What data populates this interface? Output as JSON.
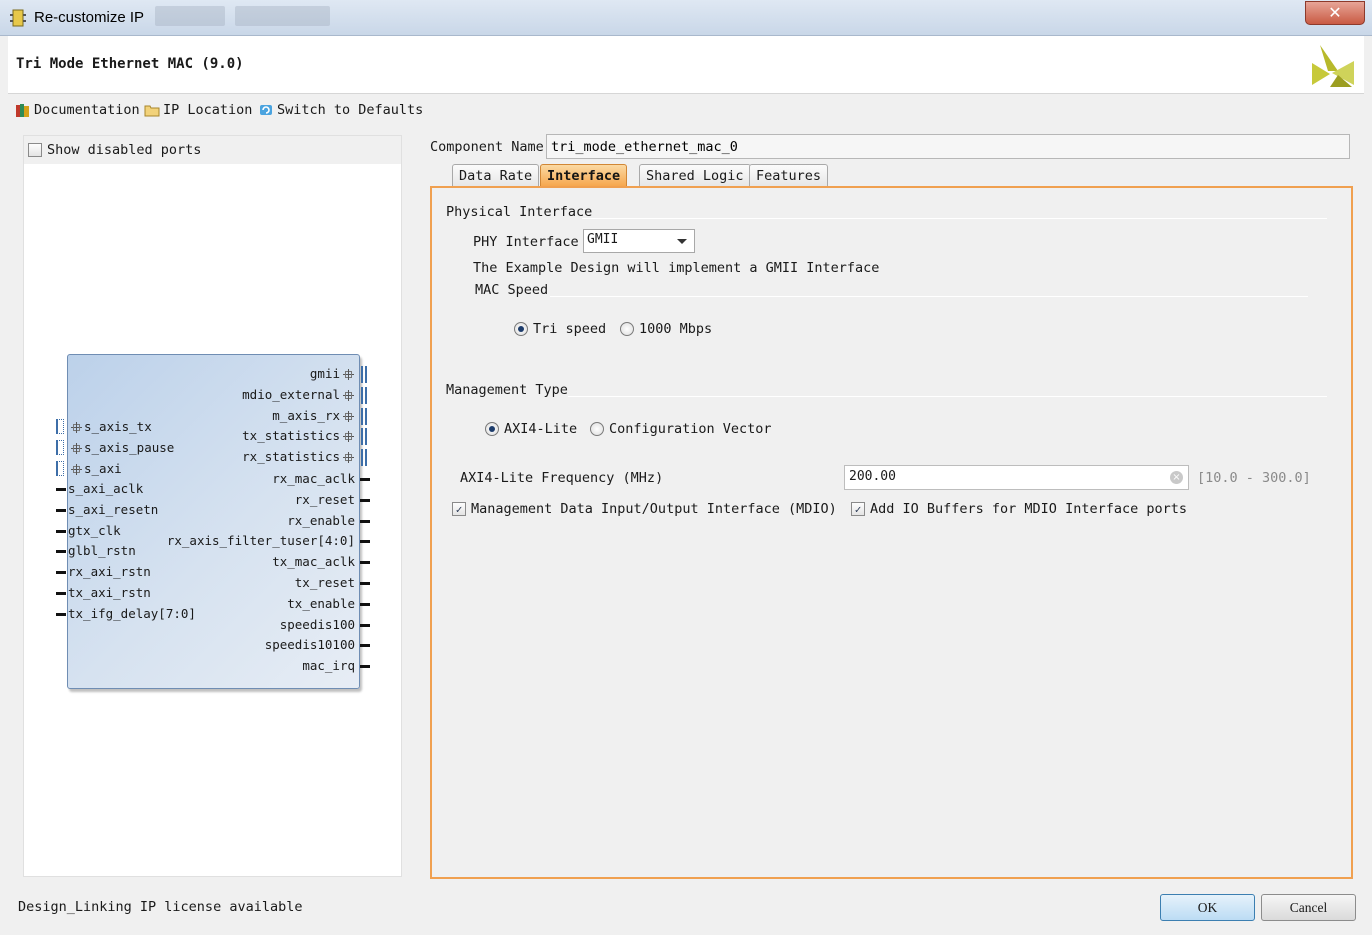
{
  "window": {
    "title": "Re-customize IP",
    "close_glyph": "✕"
  },
  "header": {
    "ip_title": "Tri Mode Ethernet MAC (9.0)",
    "logo_icon": "xilinx-logo-icon"
  },
  "toolbar": {
    "documentation": "Documentation",
    "ip_location": "IP Location",
    "switch_defaults": "Switch to Defaults"
  },
  "left_pane": {
    "show_disabled_ports_label": "Show disabled ports",
    "show_disabled_ports_checked": false,
    "block": {
      "left_bus_ports": [
        "s_axis_tx",
        "s_axis_pause",
        "s_axi"
      ],
      "left_ports": [
        "s_axi_aclk",
        "s_axi_resetn",
        "gtx_clk",
        "glbl_rstn",
        "rx_axi_rstn",
        "tx_axi_rstn",
        "tx_ifg_delay[7:0]"
      ],
      "right_bus_ports": [
        "gmii",
        "mdio_external",
        "m_axis_rx",
        "tx_statistics",
        "rx_statistics"
      ],
      "right_ports": [
        "rx_mac_aclk",
        "rx_reset",
        "rx_enable",
        "rx_axis_filter_tuser[4:0]",
        "tx_mac_aclk",
        "tx_reset",
        "tx_enable",
        "speedis100",
        "speedis10100",
        "mac_irq"
      ]
    }
  },
  "component": {
    "label": "Component Name",
    "value": "tri_mode_ethernet_mac_0"
  },
  "tabs": {
    "items": [
      "Data Rate",
      "Interface",
      "Shared Logic",
      "Features"
    ],
    "active": "Interface"
  },
  "physical_interface": {
    "title": "Physical Interface",
    "phy_label": "PHY Interface",
    "phy_value": "GMII",
    "note": "The Example Design will implement a GMII Interface",
    "mac_speed_title": "MAC Speed",
    "speed_options": [
      "Tri speed",
      "1000 Mbps"
    ],
    "speed_selected": "Tri speed"
  },
  "management": {
    "title": "Management Type",
    "options": [
      "AXI4-Lite",
      "Configuration Vector"
    ],
    "selected": "AXI4-Lite",
    "freq_label": "AXI4-Lite Frequency (MHz)",
    "freq_value": "200.00",
    "freq_range": "[10.0 - 300.0]",
    "mdio_label": "Management Data Input/Output Interface (MDIO)",
    "mdio_checked": true,
    "io_buffers_label": "Add IO Buffers for MDIO Interface ports",
    "io_buffers_checked": true
  },
  "footer": {
    "status": "Design_Linking IP license available",
    "ok": "OK",
    "cancel": "Cancel"
  },
  "colors": {
    "accent": "#f0a050",
    "tab_active": "#f6a54b",
    "block_fill": "#bcd1ea",
    "bus": "#3d6ea8"
  }
}
